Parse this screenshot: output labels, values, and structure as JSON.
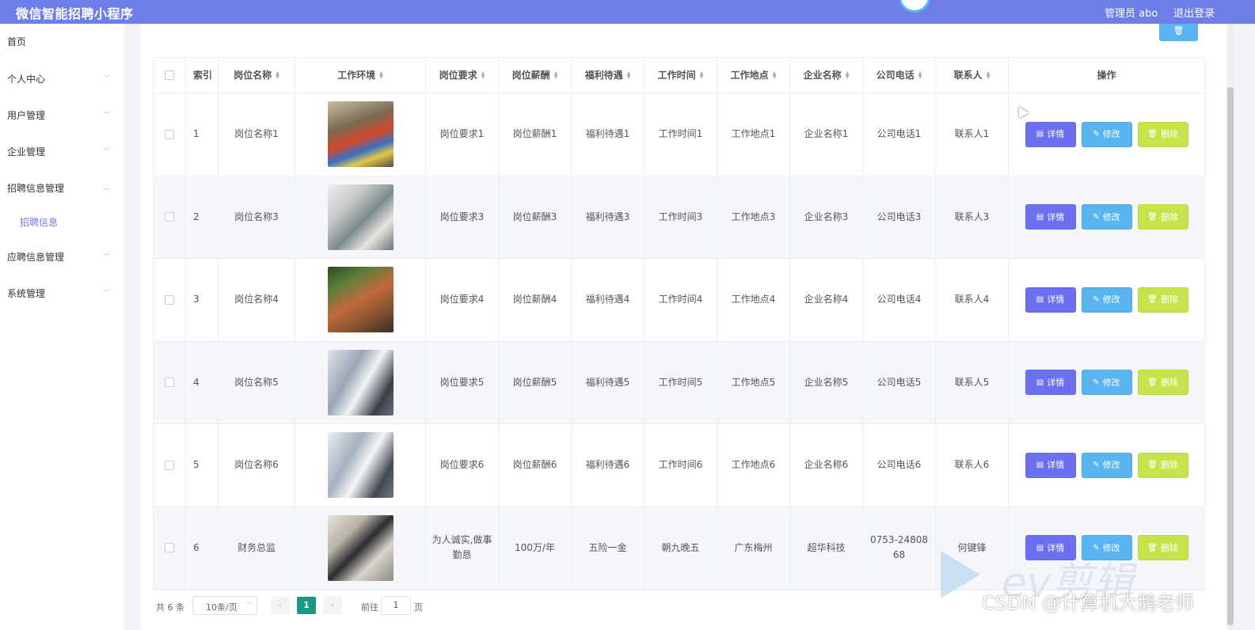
{
  "header": {
    "app_title": "微信智能招聘小程序",
    "admin_label": "管理员 abo",
    "logout_label": "退出登录"
  },
  "sidebar": {
    "items": [
      {
        "label": "首页"
      },
      {
        "label": "个人中心"
      },
      {
        "label": "用户管理"
      },
      {
        "label": "企业管理"
      },
      {
        "label": "招聘信息管理",
        "expanded": true
      },
      {
        "label": "招聘信息"
      },
      {
        "label": "应聘信息管理"
      },
      {
        "label": "系统管理"
      }
    ]
  },
  "toolbar": {
    "delete_icon": "trash-icon"
  },
  "table": {
    "headers": [
      "索引",
      "岗位名称",
      "工作环境",
      "岗位要求",
      "岗位薪酬",
      "福利待遇",
      "工作时间",
      "工作地点",
      "企业名称",
      "公司电话",
      "联系人",
      "操作"
    ],
    "rows": [
      {
        "index": "1",
        "name": "岗位名称1",
        "req": "岗位要求1",
        "salary": "岗位薪酬1",
        "welfare": "福利待遇1",
        "time": "工作时间1",
        "place": "工作地点1",
        "company": "企业名称1",
        "phone": "公司电话1",
        "contact": "联系人1"
      },
      {
        "index": "2",
        "name": "岗位名称3",
        "req": "岗位要求3",
        "salary": "岗位薪酬3",
        "welfare": "福利待遇3",
        "time": "工作时间3",
        "place": "工作地点3",
        "company": "企业名称3",
        "phone": "公司电话3",
        "contact": "联系人3"
      },
      {
        "index": "3",
        "name": "岗位名称4",
        "req": "岗位要求4",
        "salary": "岗位薪酬4",
        "welfare": "福利待遇4",
        "time": "工作时间4",
        "place": "工作地点4",
        "company": "企业名称4",
        "phone": "公司电话4",
        "contact": "联系人4"
      },
      {
        "index": "4",
        "name": "岗位名称5",
        "req": "岗位要求5",
        "salary": "岗位薪酬5",
        "welfare": "福利待遇5",
        "time": "工作时间5",
        "place": "工作地点5",
        "company": "企业名称5",
        "phone": "公司电话5",
        "contact": "联系人5"
      },
      {
        "index": "5",
        "name": "岗位名称6",
        "req": "岗位要求6",
        "salary": "岗位薪酬6",
        "welfare": "福利待遇6",
        "time": "工作时间6",
        "place": "工作地点6",
        "company": "企业名称6",
        "phone": "公司电话6",
        "contact": "联系人6"
      },
      {
        "index": "6",
        "name": "财务总监",
        "req": "为人诚实,做事勤恳",
        "salary": "100万/年",
        "welfare": "五险一金",
        "time": "朝九晚五",
        "place": "广东梅州",
        "company": "超华科技",
        "phone": "0753-2480868",
        "contact": "何键锋"
      }
    ],
    "actions": {
      "detail": "详情",
      "edit": "修改",
      "delete": "删除"
    }
  },
  "pagination": {
    "total_label": "共 6 条",
    "page_size": "10条/页",
    "current_page": "1",
    "goto_label": "前往",
    "goto_value": "1",
    "page_suffix": "页"
  },
  "watermark": {
    "ev": "ev剪辑",
    "csdn": "CSDN @计算机大鹅老师"
  },
  "colors": {
    "header": "#6e7ee8",
    "detail": "#6c6ff0",
    "edit": "#5ab4f0",
    "delete": "#c6e44a",
    "page_active": "#1a9a86"
  }
}
